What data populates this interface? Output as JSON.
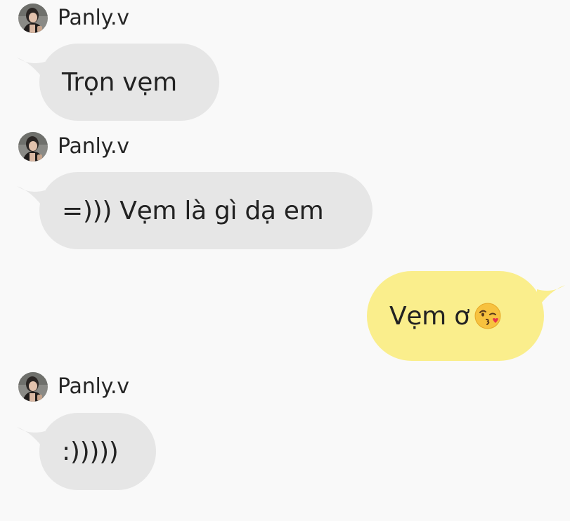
{
  "chat": {
    "messages": [
      {
        "sender": "Panly.v",
        "direction": "incoming",
        "text": "Trọn vẹm"
      },
      {
        "sender": "Panly.v",
        "direction": "incoming",
        "text": "=))) Vẹm là gì dạ em"
      },
      {
        "sender": "",
        "direction": "outgoing",
        "text": "Vẹm ơ",
        "emoji": "kissing-wink-face-icon"
      },
      {
        "sender": "Panly.v",
        "direction": "incoming",
        "text": ":)))))"
      }
    ]
  },
  "colors": {
    "background": "#f9f9f9",
    "incoming_bubble": "#e6e6e6",
    "outgoing_bubble": "#faee8c",
    "text": "#222222"
  }
}
